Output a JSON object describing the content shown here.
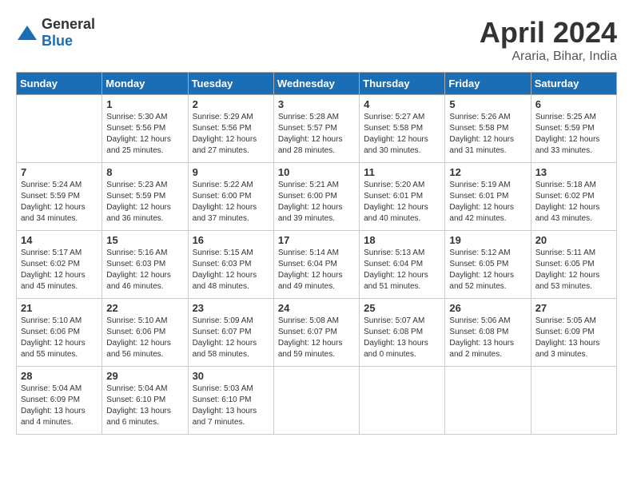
{
  "header": {
    "logo_general": "General",
    "logo_blue": "Blue",
    "month": "April 2024",
    "location": "Araria, Bihar, India"
  },
  "weekdays": [
    "Sunday",
    "Monday",
    "Tuesday",
    "Wednesday",
    "Thursday",
    "Friday",
    "Saturday"
  ],
  "weeks": [
    [
      {
        "day": "",
        "sunrise": "",
        "sunset": "",
        "daylight": ""
      },
      {
        "day": "1",
        "sunrise": "Sunrise: 5:30 AM",
        "sunset": "Sunset: 5:56 PM",
        "daylight": "Daylight: 12 hours and 25 minutes."
      },
      {
        "day": "2",
        "sunrise": "Sunrise: 5:29 AM",
        "sunset": "Sunset: 5:56 PM",
        "daylight": "Daylight: 12 hours and 27 minutes."
      },
      {
        "day": "3",
        "sunrise": "Sunrise: 5:28 AM",
        "sunset": "Sunset: 5:57 PM",
        "daylight": "Daylight: 12 hours and 28 minutes."
      },
      {
        "day": "4",
        "sunrise": "Sunrise: 5:27 AM",
        "sunset": "Sunset: 5:58 PM",
        "daylight": "Daylight: 12 hours and 30 minutes."
      },
      {
        "day": "5",
        "sunrise": "Sunrise: 5:26 AM",
        "sunset": "Sunset: 5:58 PM",
        "daylight": "Daylight: 12 hours and 31 minutes."
      },
      {
        "day": "6",
        "sunrise": "Sunrise: 5:25 AM",
        "sunset": "Sunset: 5:59 PM",
        "daylight": "Daylight: 12 hours and 33 minutes."
      }
    ],
    [
      {
        "day": "7",
        "sunrise": "Sunrise: 5:24 AM",
        "sunset": "Sunset: 5:59 PM",
        "daylight": "Daylight: 12 hours and 34 minutes."
      },
      {
        "day": "8",
        "sunrise": "Sunrise: 5:23 AM",
        "sunset": "Sunset: 5:59 PM",
        "daylight": "Daylight: 12 hours and 36 minutes."
      },
      {
        "day": "9",
        "sunrise": "Sunrise: 5:22 AM",
        "sunset": "Sunset: 6:00 PM",
        "daylight": "Daylight: 12 hours and 37 minutes."
      },
      {
        "day": "10",
        "sunrise": "Sunrise: 5:21 AM",
        "sunset": "Sunset: 6:00 PM",
        "daylight": "Daylight: 12 hours and 39 minutes."
      },
      {
        "day": "11",
        "sunrise": "Sunrise: 5:20 AM",
        "sunset": "Sunset: 6:01 PM",
        "daylight": "Daylight: 12 hours and 40 minutes."
      },
      {
        "day": "12",
        "sunrise": "Sunrise: 5:19 AM",
        "sunset": "Sunset: 6:01 PM",
        "daylight": "Daylight: 12 hours and 42 minutes."
      },
      {
        "day": "13",
        "sunrise": "Sunrise: 5:18 AM",
        "sunset": "Sunset: 6:02 PM",
        "daylight": "Daylight: 12 hours and 43 minutes."
      }
    ],
    [
      {
        "day": "14",
        "sunrise": "Sunrise: 5:17 AM",
        "sunset": "Sunset: 6:02 PM",
        "daylight": "Daylight: 12 hours and 45 minutes."
      },
      {
        "day": "15",
        "sunrise": "Sunrise: 5:16 AM",
        "sunset": "Sunset: 6:03 PM",
        "daylight": "Daylight: 12 hours and 46 minutes."
      },
      {
        "day": "16",
        "sunrise": "Sunrise: 5:15 AM",
        "sunset": "Sunset: 6:03 PM",
        "daylight": "Daylight: 12 hours and 48 minutes."
      },
      {
        "day": "17",
        "sunrise": "Sunrise: 5:14 AM",
        "sunset": "Sunset: 6:04 PM",
        "daylight": "Daylight: 12 hours and 49 minutes."
      },
      {
        "day": "18",
        "sunrise": "Sunrise: 5:13 AM",
        "sunset": "Sunset: 6:04 PM",
        "daylight": "Daylight: 12 hours and 51 minutes."
      },
      {
        "day": "19",
        "sunrise": "Sunrise: 5:12 AM",
        "sunset": "Sunset: 6:05 PM",
        "daylight": "Daylight: 12 hours and 52 minutes."
      },
      {
        "day": "20",
        "sunrise": "Sunrise: 5:11 AM",
        "sunset": "Sunset: 6:05 PM",
        "daylight": "Daylight: 12 hours and 53 minutes."
      }
    ],
    [
      {
        "day": "21",
        "sunrise": "Sunrise: 5:10 AM",
        "sunset": "Sunset: 6:06 PM",
        "daylight": "Daylight: 12 hours and 55 minutes."
      },
      {
        "day": "22",
        "sunrise": "Sunrise: 5:10 AM",
        "sunset": "Sunset: 6:06 PM",
        "daylight": "Daylight: 12 hours and 56 minutes."
      },
      {
        "day": "23",
        "sunrise": "Sunrise: 5:09 AM",
        "sunset": "Sunset: 6:07 PM",
        "daylight": "Daylight: 12 hours and 58 minutes."
      },
      {
        "day": "24",
        "sunrise": "Sunrise: 5:08 AM",
        "sunset": "Sunset: 6:07 PM",
        "daylight": "Daylight: 12 hours and 59 minutes."
      },
      {
        "day": "25",
        "sunrise": "Sunrise: 5:07 AM",
        "sunset": "Sunset: 6:08 PM",
        "daylight": "Daylight: 13 hours and 0 minutes."
      },
      {
        "day": "26",
        "sunrise": "Sunrise: 5:06 AM",
        "sunset": "Sunset: 6:08 PM",
        "daylight": "Daylight: 13 hours and 2 minutes."
      },
      {
        "day": "27",
        "sunrise": "Sunrise: 5:05 AM",
        "sunset": "Sunset: 6:09 PM",
        "daylight": "Daylight: 13 hours and 3 minutes."
      }
    ],
    [
      {
        "day": "28",
        "sunrise": "Sunrise: 5:04 AM",
        "sunset": "Sunset: 6:09 PM",
        "daylight": "Daylight: 13 hours and 4 minutes."
      },
      {
        "day": "29",
        "sunrise": "Sunrise: 5:04 AM",
        "sunset": "Sunset: 6:10 PM",
        "daylight": "Daylight: 13 hours and 6 minutes."
      },
      {
        "day": "30",
        "sunrise": "Sunrise: 5:03 AM",
        "sunset": "Sunset: 6:10 PM",
        "daylight": "Daylight: 13 hours and 7 minutes."
      },
      {
        "day": "",
        "sunrise": "",
        "sunset": "",
        "daylight": ""
      },
      {
        "day": "",
        "sunrise": "",
        "sunset": "",
        "daylight": ""
      },
      {
        "day": "",
        "sunrise": "",
        "sunset": "",
        "daylight": ""
      },
      {
        "day": "",
        "sunrise": "",
        "sunset": "",
        "daylight": ""
      }
    ]
  ]
}
